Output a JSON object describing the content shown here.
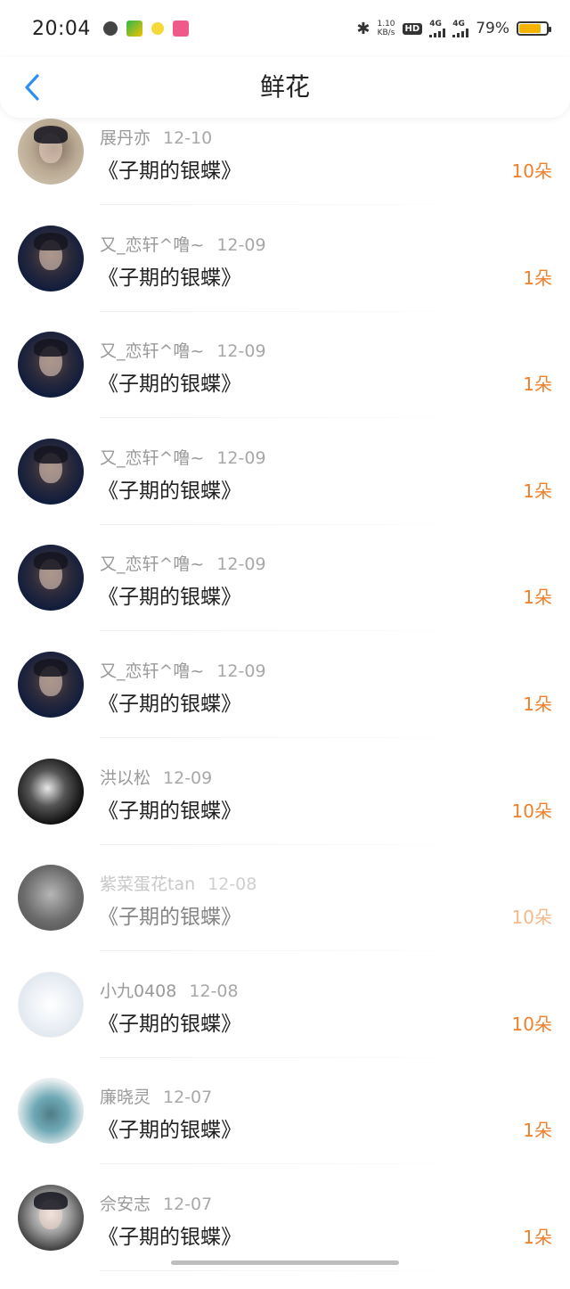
{
  "status_bar": {
    "time": "20:04",
    "net_speed_value": "1.10",
    "net_speed_unit": "KB/s",
    "hd_label": "HD",
    "net1": "4G",
    "net2": "4G",
    "battery_percent": "79%",
    "battery_level": 0.79,
    "battery_color": "#f5b301"
  },
  "header": {
    "back_icon": "chevron-left-icon",
    "title": "鲜花"
  },
  "accent_color": "#f07f2a",
  "nav_color": "#2e8ff0",
  "rows": [
    {
      "user": "展丹亦",
      "date": "12-10",
      "work": "《子期的银蝶》",
      "count": "10朵",
      "avatar": "av-1"
    },
    {
      "user": "又_恋轩^噜~",
      "date": "12-09",
      "work": "《子期的银蝶》",
      "count": "1朵",
      "avatar": "av-boy"
    },
    {
      "user": "又_恋轩^噜~",
      "date": "12-09",
      "work": "《子期的银蝶》",
      "count": "1朵",
      "avatar": "av-boy"
    },
    {
      "user": "又_恋轩^噜~",
      "date": "12-09",
      "work": "《子期的银蝶》",
      "count": "1朵",
      "avatar": "av-boy"
    },
    {
      "user": "又_恋轩^噜~",
      "date": "12-09",
      "work": "《子期的银蝶》",
      "count": "1朵",
      "avatar": "av-boy"
    },
    {
      "user": "又_恋轩^噜~",
      "date": "12-09",
      "work": "《子期的银蝶》",
      "count": "1朵",
      "avatar": "av-boy"
    },
    {
      "user": "洪以松",
      "date": "12-09",
      "work": "《子期的银蝶》",
      "count": "10朵",
      "avatar": "av-girl"
    },
    {
      "user": "紫菜蛋花tan",
      "date": "12-08",
      "work": "《子期的银蝶》",
      "count": "10朵",
      "avatar": "av-grey"
    },
    {
      "user": "小九0408",
      "date": "12-08",
      "work": "《子期的银蝶》",
      "count": "10朵",
      "avatar": "av-sketch"
    },
    {
      "user": "廉晓灵",
      "date": "12-07",
      "work": "《子期的银蝶》",
      "count": "1朵",
      "avatar": "av-dino"
    },
    {
      "user": "佘安志",
      "date": "12-07",
      "work": "《子期的银蝶》",
      "count": "1朵",
      "avatar": "av-bw"
    }
  ]
}
